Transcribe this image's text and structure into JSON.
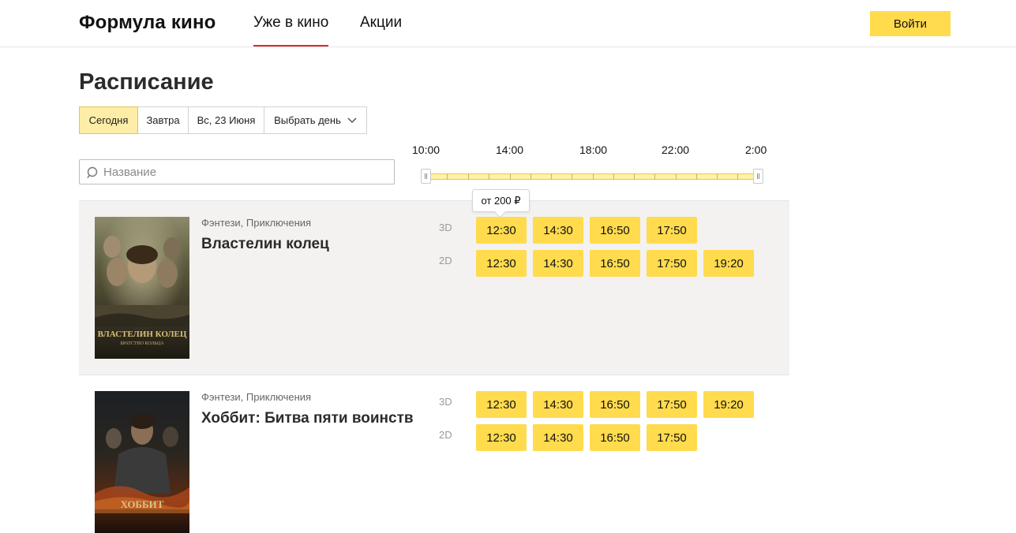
{
  "header": {
    "logo": "Формула кино",
    "nav": [
      {
        "label": "Уже в кино",
        "active": true
      },
      {
        "label": "Акции",
        "active": false
      }
    ],
    "login_label": "Войти"
  },
  "schedule": {
    "title": "Расписание",
    "day_tabs": [
      {
        "label": "Сегодня",
        "selected": true
      },
      {
        "label": "Завтра",
        "selected": false
      },
      {
        "label": "Вс, 23 Июня",
        "selected": false
      },
      {
        "label": "Выбрать день",
        "selected": false,
        "dropdown": true
      }
    ],
    "search": {
      "placeholder": "Название",
      "value": ""
    },
    "time_slider": {
      "labels": [
        "10:00",
        "14:00",
        "18:00",
        "22:00",
        "2:00"
      ],
      "range_start": "10:00",
      "range_end": "2:00"
    },
    "tooltip": "от 200 ₽"
  },
  "movies": [
    {
      "genre": "Фэнтези, Приключения",
      "title": "Властелин колец",
      "poster_text": "ВЛАСТЕЛИН КОЛЕЦ",
      "poster_subtext": "БРАТСТВО КОЛЬЦА",
      "formats": [
        {
          "format": "3D",
          "times": [
            "12:30",
            "14:30",
            "16:50",
            "17:50"
          ]
        },
        {
          "format": "2D",
          "times": [
            "12:30",
            "14:30",
            "16:50",
            "17:50",
            "19:20"
          ]
        }
      ]
    },
    {
      "genre": "Фэнтези, Приключения",
      "title": "Хоббит: Битва пяти воинств",
      "poster_text": "ХОББИТ",
      "poster_subtext": "",
      "formats": [
        {
          "format": "3D",
          "times": [
            "12:30",
            "14:30",
            "16:50",
            "17:50",
            "19:20"
          ]
        },
        {
          "format": "2D",
          "times": [
            "12:30",
            "14:30",
            "16:50",
            "17:50"
          ]
        }
      ]
    }
  ],
  "colors": {
    "accent": "#ffdb4d",
    "nav_underline": "#e3262a",
    "selected_tab": "#fdeda6",
    "row_shade": "#f3f2f0"
  }
}
